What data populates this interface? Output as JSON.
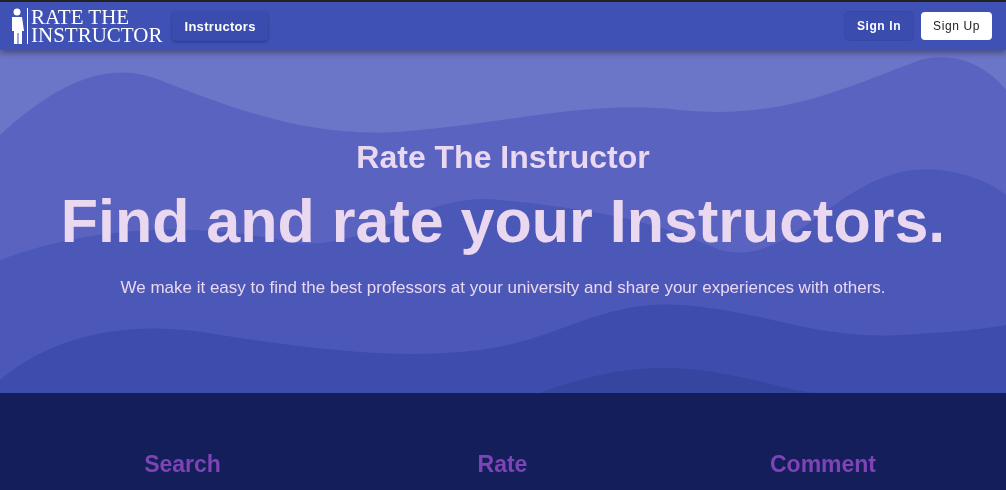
{
  "navbar": {
    "logo_lines": [
      "RATE THE",
      "INSTRUCTOR"
    ],
    "links": [
      {
        "label": "Instructors"
      }
    ],
    "buttons": [
      {
        "label": "Sign In",
        "kind": "text"
      },
      {
        "label": "Sign Up",
        "kind": "filled"
      }
    ]
  },
  "hero": {
    "eyebrow": "Rate The Instructor",
    "headline": "Find and rate your Instructors.",
    "description": "We make it easy to find the best professors at your university and share your experiences with others."
  },
  "features": [
    {
      "title": "Search"
    },
    {
      "title": "Rate"
    },
    {
      "title": "Comment"
    }
  ]
}
